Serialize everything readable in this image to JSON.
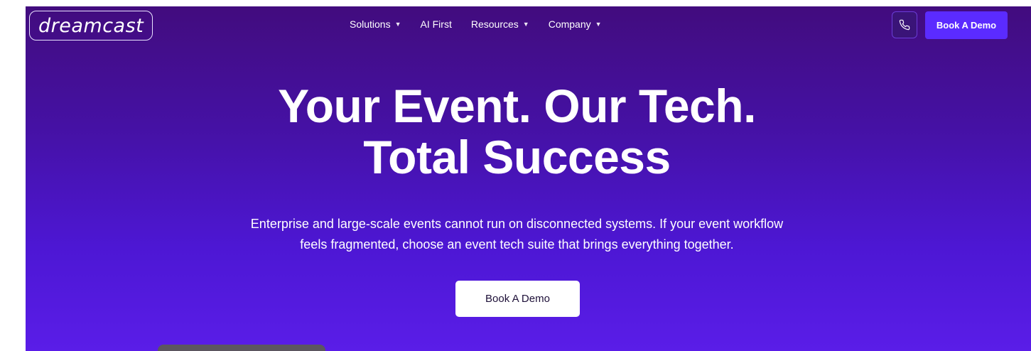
{
  "header": {
    "logo_text": "dreamcast",
    "nav": [
      {
        "label": "Solutions",
        "has_dropdown": true
      },
      {
        "label": "AI First",
        "has_dropdown": false
      },
      {
        "label": "Resources",
        "has_dropdown": true
      },
      {
        "label": "Company",
        "has_dropdown": true
      }
    ],
    "phone_icon": "phone-icon",
    "cta_label": "Book A Demo"
  },
  "hero": {
    "title_line1": "Your Event. Our Tech.",
    "title_line2": "Total Success",
    "subtitle_line1": "Enterprise and large-scale events cannot run on disconnected systems. If your event workflow",
    "subtitle_line2": "feels fragmented, choose an event tech suite that brings everything together.",
    "cta_label": "Book A Demo"
  },
  "colors": {
    "bg_top": "#420c7e",
    "bg_bottom": "#5a1de8",
    "accent_button": "#5b2bff",
    "text": "#ffffff"
  }
}
